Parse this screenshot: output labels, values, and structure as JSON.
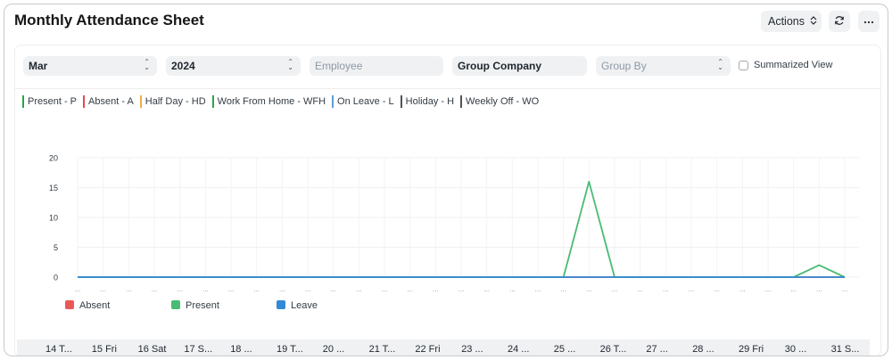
{
  "header": {
    "title": "Monthly Attendance Sheet",
    "actions_label": "Actions",
    "refresh_icon": "refresh-icon",
    "more_icon": "more-icon"
  },
  "filters": {
    "month": "Mar",
    "year": "2024",
    "employee_placeholder": "Employee",
    "company": "Group Company",
    "group_by_placeholder": "Group By",
    "summarized_label": "Summarized View",
    "summarized_checked": false
  },
  "legend": [
    {
      "label": "Present - P",
      "color": "#28a745"
    },
    {
      "label": "Absent - A",
      "color": "#e24c4c"
    },
    {
      "label": "Half Day - HD",
      "color": "#f0ad4e"
    },
    {
      "label": "Work From Home - WFH",
      "color": "#28a745"
    },
    {
      "label": "On Leave - L",
      "color": "#5e9ed6"
    },
    {
      "label": "Holiday - H",
      "color": "#525252"
    },
    {
      "label": "Weekly Off - WO",
      "color": "#525252"
    }
  ],
  "chart_data": {
    "type": "line",
    "x": [
      "...",
      "...",
      "...",
      "...",
      "...",
      "...",
      "...",
      "...",
      "...",
      "...",
      "...",
      "...",
      "...",
      "...",
      "...",
      "...",
      "...",
      "...",
      "...",
      "...",
      "...",
      "...",
      "...",
      "...",
      "...",
      "...",
      "...",
      "...",
      "...",
      "...",
      "..."
    ],
    "series": [
      {
        "name": "Absent",
        "color": "#eb5757",
        "values": [
          0,
          0,
          0,
          0,
          0,
          0,
          0,
          0,
          0,
          0,
          0,
          0,
          0,
          0,
          0,
          0,
          0,
          0,
          0,
          0,
          0,
          0,
          0,
          0,
          0,
          0,
          0,
          0,
          0,
          0,
          0
        ]
      },
      {
        "name": "Present",
        "color": "#48bb74",
        "values": [
          0,
          0,
          0,
          0,
          0,
          0,
          0,
          0,
          0,
          0,
          0,
          0,
          0,
          0,
          0,
          0,
          0,
          0,
          0,
          0,
          16,
          0,
          0,
          0,
          0,
          0,
          0,
          0,
          0,
          2,
          0
        ]
      },
      {
        "name": "Leave",
        "color": "#318ad8",
        "values": [
          0,
          0,
          0,
          0,
          0,
          0,
          0,
          0,
          0,
          0,
          0,
          0,
          0,
          0,
          0,
          0,
          0,
          0,
          0,
          0,
          0,
          0,
          0,
          0,
          0,
          0,
          0,
          0,
          0,
          0,
          0
        ]
      }
    ],
    "y_ticks": [
      "20",
      "15",
      "10",
      "5",
      "0"
    ],
    "ylim": [
      0,
      20
    ],
    "grid": true,
    "legend_position": "bottom-left"
  },
  "date_columns": [
    "14 T...",
    "15 Fri",
    "16 Sat",
    "17 S...",
    "18 ...",
    "19 T...",
    "20 ...",
    "21 T...",
    "22 Fri",
    "23 ...",
    "24 ...",
    "25 ...",
    "26 T...",
    "27 ...",
    "28 ...",
    "29 Fri",
    "30 ...",
    "31 S..."
  ]
}
